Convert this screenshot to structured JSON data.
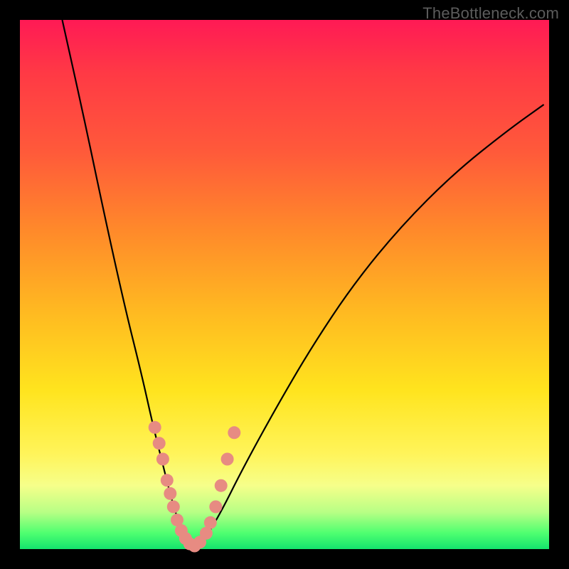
{
  "watermark": "TheBottleneck.com",
  "chart_data": {
    "type": "line",
    "title": "",
    "xlabel": "",
    "ylabel": "",
    "xlim": [
      0,
      100
    ],
    "ylim": [
      0,
      100
    ],
    "series": [
      {
        "name": "bottleneck-curve",
        "x": [
          8,
          12,
          16,
          20,
          23,
          25,
          27,
          28.5,
          30,
          31.5,
          33,
          35,
          38,
          42,
          48,
          55,
          63,
          72,
          82,
          92,
          99
        ],
        "values": [
          100,
          82,
          63,
          45,
          33,
          24,
          16,
          10,
          5,
          2,
          0.5,
          2,
          7,
          15,
          26,
          38,
          50,
          61,
          71,
          79,
          84
        ]
      }
    ],
    "markers": {
      "name": "highlighted-points",
      "color": "#e78b82",
      "x": [
        25.5,
        26.3,
        27.0,
        27.8,
        28.4,
        29.0,
        29.7,
        30.5,
        31.3,
        32.1,
        33.0,
        34.0,
        35.2,
        36.0,
        37.0,
        38.0,
        39.2,
        40.5
      ],
      "values": [
        23,
        20,
        17,
        13,
        10.5,
        8,
        5.5,
        3.5,
        2,
        1,
        0.6,
        1.3,
        3,
        5,
        8,
        12,
        17,
        22
      ]
    },
    "background_gradient": {
      "top": "#ff1a55",
      "upper_mid": "#ff8a2a",
      "mid": "#ffe41e",
      "lower": "#14e36d"
    }
  }
}
